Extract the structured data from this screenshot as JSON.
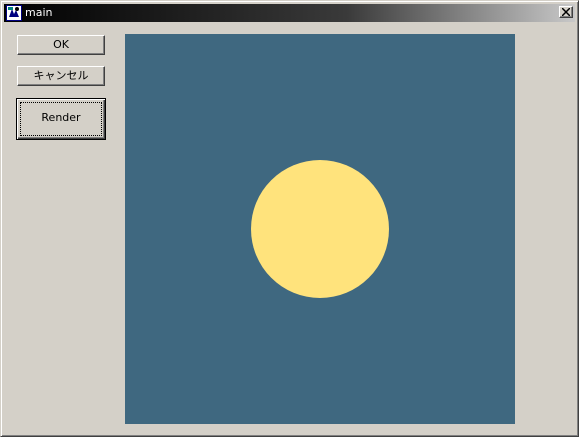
{
  "window": {
    "title": "main",
    "app_icon": "app-icon",
    "close_icon": "close-icon"
  },
  "buttons": {
    "ok_label": "OK",
    "cancel_label": "キャンセル",
    "render_label": "Render"
  },
  "render": {
    "background_color": "#3f6880",
    "circle_color": "#ffe37c",
    "shape": "circle"
  },
  "colors": {
    "dialog_face": "#d4d0c8"
  }
}
